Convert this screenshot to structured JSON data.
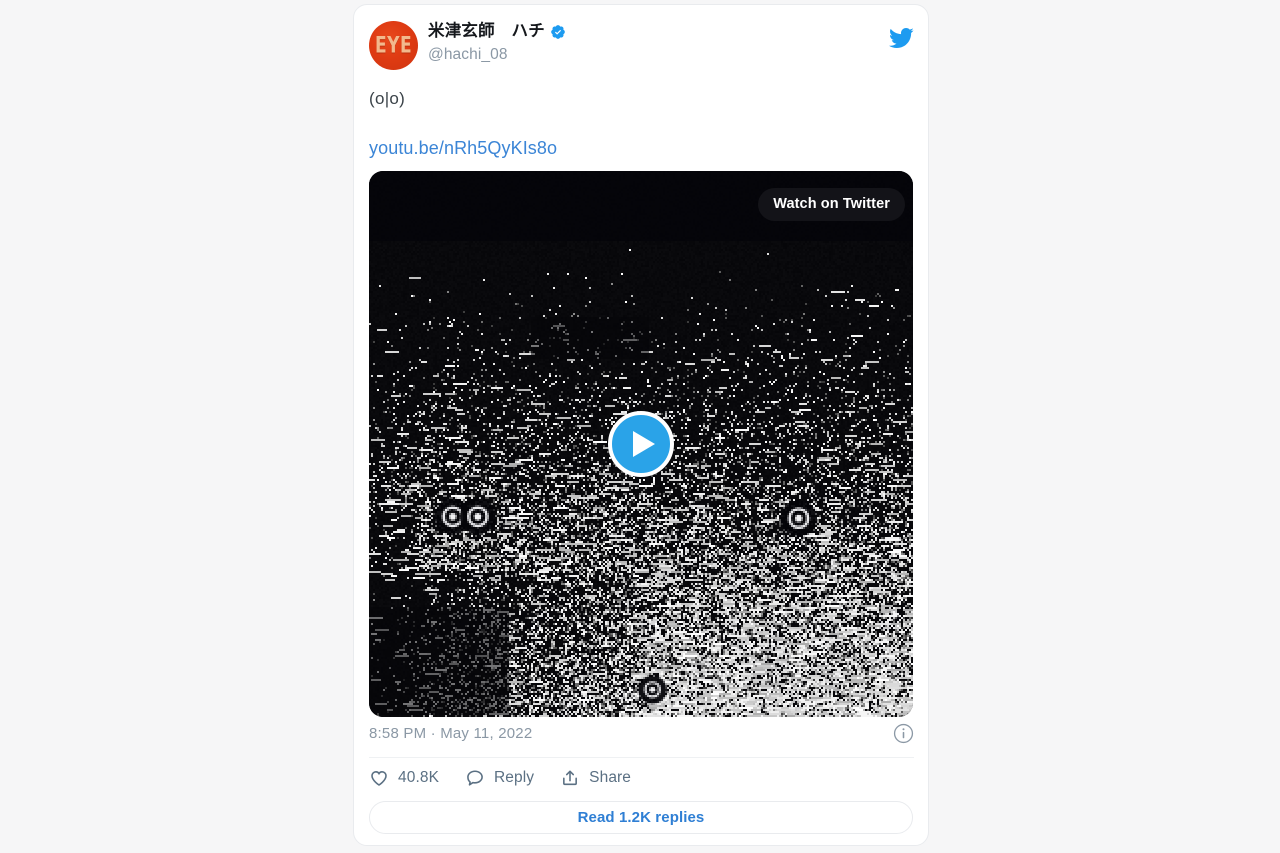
{
  "page": {
    "background_color": "#f6f6f7"
  },
  "tweet": {
    "author": {
      "avatar_text": "EYE",
      "avatar_color": "#df3b13",
      "display_name": "米津玄師　ハチ",
      "handle": "@hachi_08",
      "verified": true,
      "verified_color": "#1d9bf0"
    },
    "brand_icon": "twitter-bird-icon",
    "brand_color": "#1d9bf0",
    "body_text": "(o|o)",
    "link_text": "youtu.be/nRh5QyKIs8o",
    "link_color": "#3b85d6",
    "media": {
      "type": "video",
      "watch_badge_label": "Watch on Twitter",
      "play_button_color": "#2aa3e8",
      "thumbnail_description": "black and white dithered noise with circular eye shapes"
    },
    "timestamp": "8:58 PM · May 11, 2022",
    "info_icon": "info-circle-icon",
    "actions": [
      {
        "icon": "heart-icon",
        "label": "40.8K"
      },
      {
        "icon": "reply-bubble-icon",
        "label": "Reply"
      },
      {
        "icon": "share-upload-icon",
        "label": "Share"
      }
    ],
    "replies_button_label": "Read 1.2K replies",
    "replies_button_color": "#2f7fd4"
  }
}
